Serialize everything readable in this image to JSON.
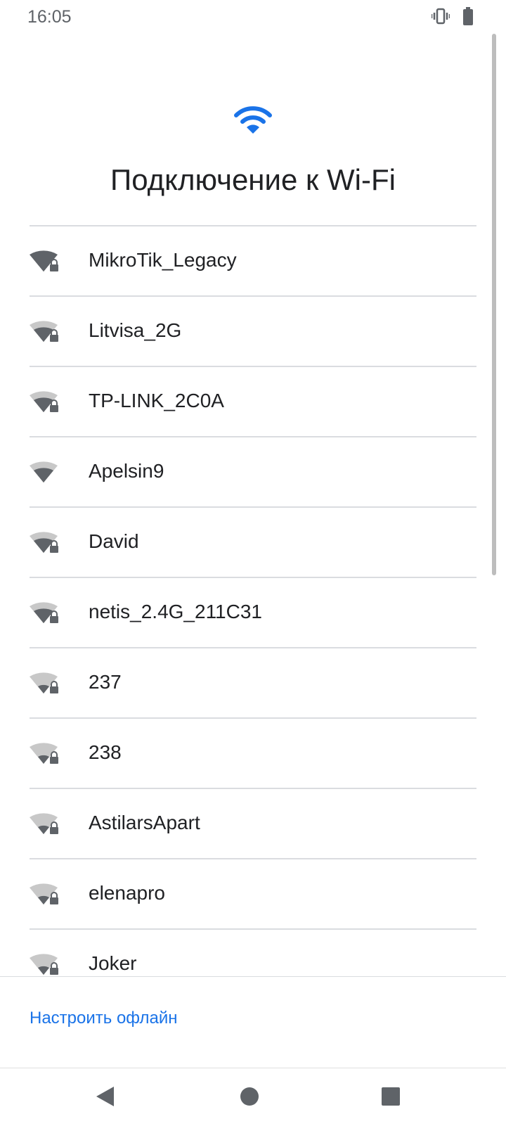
{
  "status": {
    "time": "16:05",
    "icons": [
      "vibrate-icon",
      "battery-icon"
    ]
  },
  "page": {
    "title": "Подключение к Wi-Fi",
    "hero_icon": "wifi-icon",
    "accent": "#1a73e8"
  },
  "networks": [
    {
      "ssid": "MikroTik_Legacy",
      "secured": true,
      "signal": "full"
    },
    {
      "ssid": "Litvisa_2G",
      "secured": true,
      "signal": "medium"
    },
    {
      "ssid": "TP-LINK_2C0A",
      "secured": true,
      "signal": "medium"
    },
    {
      "ssid": "Apelsin9",
      "secured": false,
      "signal": "medium"
    },
    {
      "ssid": "David",
      "secured": true,
      "signal": "medium"
    },
    {
      "ssid": "netis_2.4G_211C31",
      "secured": true,
      "signal": "medium"
    },
    {
      "ssid": "237",
      "secured": true,
      "signal": "low"
    },
    {
      "ssid": "238",
      "secured": true,
      "signal": "low"
    },
    {
      "ssid": "AstilarsApart",
      "secured": true,
      "signal": "low"
    },
    {
      "ssid": "elenapro",
      "secured": true,
      "signal": "low"
    },
    {
      "ssid": "Joker",
      "secured": true,
      "signal": "low"
    }
  ],
  "footer": {
    "offline_label": "Настроить офлайн"
  },
  "navbar": {
    "buttons": [
      "back-icon",
      "home-icon",
      "recents-icon"
    ]
  }
}
